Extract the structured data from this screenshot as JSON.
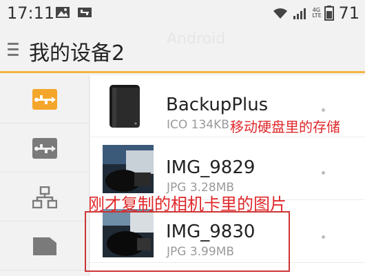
{
  "status_bar": {
    "time": "17:11",
    "battery": "71",
    "net_top": "4G",
    "net_bottom": "LTE",
    "icons": [
      "image-icon",
      "usb-notification-icon",
      "wifi-icon",
      "signal-icon",
      "battery-icon"
    ]
  },
  "app_bar": {
    "title": "我的设备2",
    "ghost_text": "Android"
  },
  "sidebar": {
    "items": [
      {
        "icon": "usb-icon",
        "active": true
      },
      {
        "icon": "usb-icon",
        "active": false
      },
      {
        "icon": "network-icon",
        "active": false
      },
      {
        "icon": "sd-card-icon",
        "active": false
      }
    ]
  },
  "files": [
    {
      "name": "BackupPlus",
      "type": "ICO",
      "size": "134KB",
      "meta": "ICO 134KB"
    },
    {
      "name": "IMG_9829",
      "type": "JPG",
      "size": "3.28MB",
      "meta": "JPG 3.28MB"
    },
    {
      "name": "IMG_9830",
      "type": "JPG",
      "size": "3.99MB",
      "meta": "JPG 3.99MB"
    }
  ],
  "annotations": {
    "hard_drive": "移动硬盘里的存储",
    "copied_from_card": "刚才复制的相机卡里的图片"
  },
  "colors": {
    "accent": "#f4b443",
    "annotation": "#e0282a",
    "background": "#f2f2f2"
  }
}
